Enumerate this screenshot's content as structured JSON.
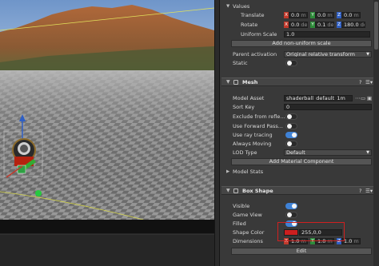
{
  "transform": {
    "values_header": "Values",
    "translate_label": "Translate",
    "translate": {
      "x": "0.0",
      "y": "0.0",
      "z": "0.0",
      "unit": "m"
    },
    "rotate_label": "Rotate",
    "rotate": {
      "x": "0.0",
      "y": "0.1",
      "z": "180.0",
      "unit": "deg"
    },
    "uniform_scale_label": "Uniform Scale",
    "uniform_scale": "1.0",
    "add_scale_button": "Add non-uniform scale",
    "parent_activation_label": "Parent activation",
    "parent_activation_value": "Original relative transform",
    "static_label": "Static",
    "static_on": false
  },
  "mesh": {
    "title": "Mesh",
    "model_asset_label": "Model Asset",
    "model_asset_value": "shaderball_default_1m",
    "sort_key_label": "Sort Key",
    "sort_key_value": "0",
    "exclude_label": "Exclude from refle...",
    "exclude_on": false,
    "forward_pass_label": "Use Forward Pass...",
    "forward_pass_on": false,
    "ray_tracing_label": "Use ray tracing",
    "ray_tracing_on": true,
    "always_moving_label": "Always Moving",
    "always_moving_on": false,
    "lod_type_label": "LOD Type",
    "lod_type_value": "Default",
    "add_material_button": "Add Material Component",
    "model_stats_label": "Model Stats"
  },
  "box_shape": {
    "title": "Box Shape",
    "visible_label": "Visible",
    "visible_on": true,
    "game_view_label": "Game View",
    "game_view_on": false,
    "filled_label": "Filled",
    "filled_on": true,
    "shape_color_label": "Shape Color",
    "shape_color_value": "255,0,0",
    "shape_color_swatch": "#cc1f1f",
    "dimensions_label": "Dimensions",
    "dimensions": {
      "x": "1.0",
      "y": "1.0",
      "z": "1.0",
      "unit": "m"
    },
    "edit_button": "Edit"
  },
  "colors": {
    "accent": "#3f82d6",
    "x_axis": "#c0392b",
    "y_axis": "#2e8b3a",
    "z_axis": "#2f5fc4",
    "highlight_box": "#d02020"
  }
}
